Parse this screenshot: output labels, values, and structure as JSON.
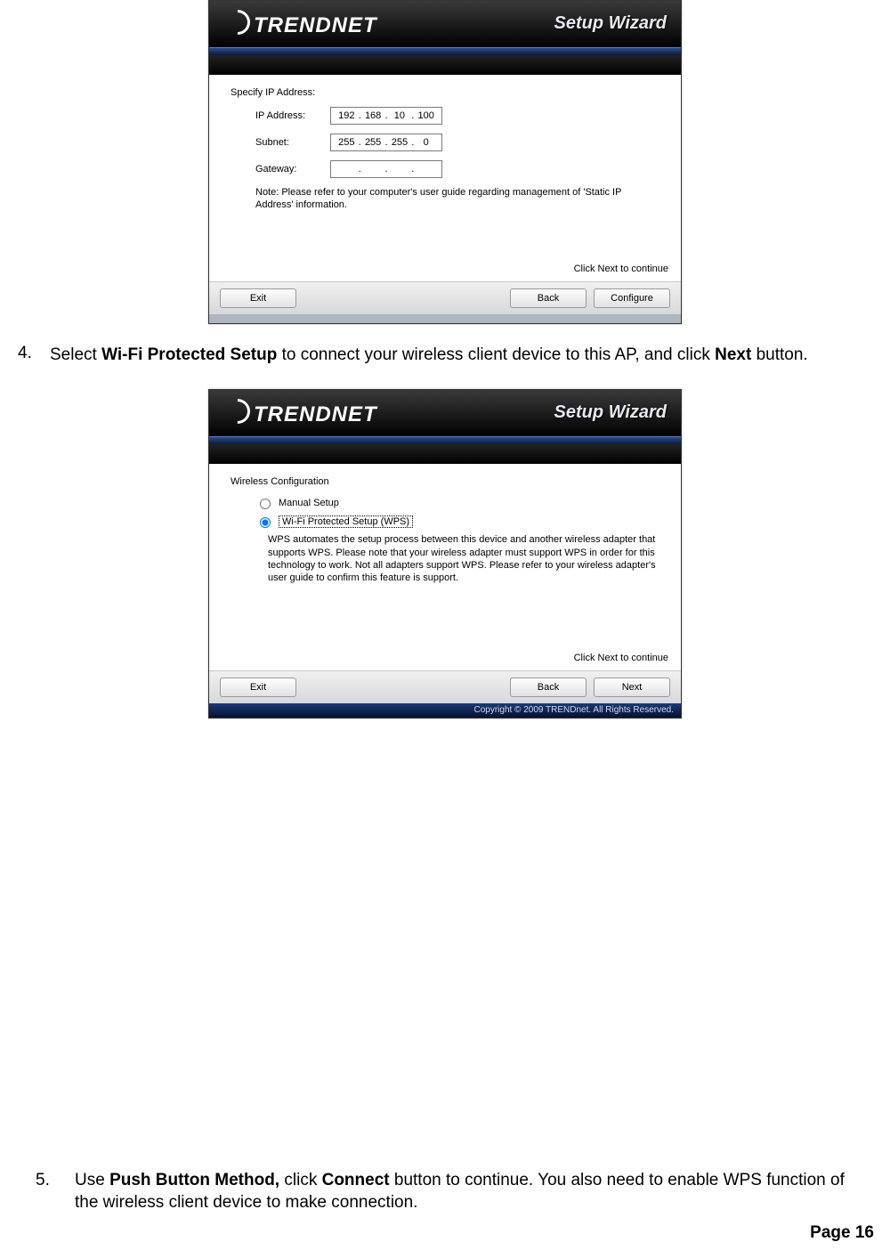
{
  "brand": "TRENDNET",
  "wizard_title": "Setup Wizard",
  "shot1": {
    "section_label": "Specify IP Address:",
    "fields": {
      "ip_label": "IP Address:",
      "ip_value": [
        "192",
        "168",
        "10",
        "100"
      ],
      "subnet_label": "Subnet:",
      "subnet_value": [
        "255",
        "255",
        "255",
        "0"
      ],
      "gateway_label": "Gateway:",
      "gateway_value": [
        "",
        "",
        "",
        ""
      ]
    },
    "note": "Note: Please refer to your computer's user guide regarding management of 'Static IP Address' information.",
    "hint": "Click Next to continue",
    "buttons": {
      "exit": "Exit",
      "back": "Back",
      "configure": "Configure"
    }
  },
  "step4": {
    "num": "4.",
    "pre": "Select ",
    "bold1": "Wi-Fi Protected Setup",
    "mid": " to connect your wireless client device to this AP, and click ",
    "bold2": "Next",
    "post": " button."
  },
  "shot2": {
    "section_label": "Wireless Configuration",
    "radio1": "Manual Setup",
    "radio2": "Wi-Fi Protected Setup (WPS)",
    "wps_desc": "WPS automates the setup process between this device and another wireless adapter that supports WPS. Please note that your wireless adapter must support WPS in order for this technology to work. Not all adapters support WPS. Please refer to your wireless adapter's user guide to confirm this feature is support.",
    "hint": "Click Next to continue",
    "buttons": {
      "exit": "Exit",
      "back": "Back",
      "next": "Next"
    },
    "copyright": "Copyright © 2009 TRENDnet. All Rights Reserved."
  },
  "step5": {
    "num": "5.",
    "pre": "Use ",
    "bold1": "Push Button Method,",
    "mid": " click ",
    "bold2": "Connect",
    "post": " button to continue. You also need to enable WPS function of the wireless client device to make connection."
  },
  "page_label": "Page  16"
}
